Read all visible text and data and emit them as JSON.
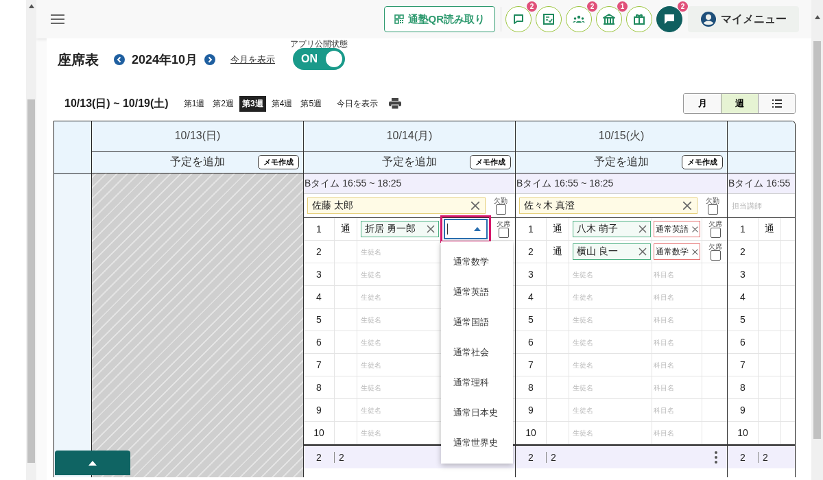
{
  "header": {
    "qr_button": "通塾QR読み取り",
    "icon_buttons": [
      {
        "kind": "chat",
        "badge": "2"
      },
      {
        "kind": "checklist"
      },
      {
        "kind": "group",
        "badge": "2"
      },
      {
        "kind": "school",
        "badge": "1"
      },
      {
        "kind": "gift"
      },
      {
        "kind": "message",
        "badge": "2"
      }
    ],
    "my_menu": "マイメニュー"
  },
  "title": "座席表",
  "month": "2024年10月",
  "this_month_link": "今月を表示",
  "publish": {
    "label": "アプリ公開状態",
    "text": "ON",
    "on": true
  },
  "week": {
    "range": "10/13(日) ~ 10/19(土)",
    "weeks": [
      {
        "label": "第1週",
        "selected": false
      },
      {
        "label": "第2週",
        "selected": false
      },
      {
        "label": "第3週",
        "selected": true
      },
      {
        "label": "第4週",
        "selected": false
      },
      {
        "label": "第5週",
        "selected": false
      }
    ],
    "today_link": "今日を表示"
  },
  "view_modes": [
    {
      "kind": "text",
      "label": "月",
      "selected": false
    },
    {
      "kind": "text",
      "label": "週",
      "selected": true
    },
    {
      "kind": "list",
      "selected": false
    }
  ],
  "days": [
    {
      "date": "10/13(日)",
      "add": "予定を追加",
      "memo": "メモ作成",
      "closed": true
    },
    {
      "date": "10/14(月)",
      "add": "予定を追加",
      "memo": "メモ作成",
      "closed": false,
      "slot": {
        "time": "Bタイム 16:55 ~ 18:25",
        "teacher": {
          "name": "佐藤 太郎",
          "absent_label": "欠勤",
          "absent": false
        },
        "rows": [
          {
            "no": "1",
            "type": "通",
            "student": "折居 勇一郎",
            "subject_focused": true,
            "absent_label": "欠席",
            "absent": false
          },
          {
            "no": "2",
            "student_placeholder": "生徒名"
          },
          {
            "no": "3",
            "student_placeholder": "生徒名"
          },
          {
            "no": "4",
            "student_placeholder": "生徒名"
          },
          {
            "no": "5",
            "student_placeholder": "生徒名"
          },
          {
            "no": "6",
            "student_placeholder": "生徒名"
          },
          {
            "no": "7",
            "student_placeholder": "生徒名"
          },
          {
            "no": "8",
            "student_placeholder": "生徒名"
          },
          {
            "no": "9",
            "student_placeholder": "生徒名"
          },
          {
            "no": "10",
            "student_placeholder": "生徒名"
          }
        ],
        "footer": [
          "2",
          "2"
        ],
        "menu": false
      }
    },
    {
      "date": "10/15(火)",
      "add": "予定を追加",
      "memo": "メモ作成",
      "closed": false,
      "slot": {
        "time": "Bタイム 16:55 ~ 18:25",
        "teacher": {
          "name": "佐々木 真澄",
          "absent_label": "欠勤",
          "absent": false
        },
        "rows": [
          {
            "no": "1",
            "type": "通",
            "student": "八木 萌子",
            "subject": "通常英語",
            "absent_label": "欠席",
            "absent": false
          },
          {
            "no": "2",
            "type": "通",
            "student": "横山 良一",
            "subject": "通常数学",
            "absent_label": "欠席",
            "absent": false
          },
          {
            "no": "3",
            "student_placeholder": "生徒名",
            "subject_placeholder": "科目名"
          },
          {
            "no": "4",
            "student_placeholder": "生徒名",
            "subject_placeholder": "科目名"
          },
          {
            "no": "5",
            "student_placeholder": "生徒名",
            "subject_placeholder": "科目名"
          },
          {
            "no": "6",
            "student_placeholder": "生徒名",
            "subject_placeholder": "科目名"
          },
          {
            "no": "7",
            "student_placeholder": "生徒名",
            "subject_placeholder": "科目名"
          },
          {
            "no": "8",
            "student_placeholder": "生徒名",
            "subject_placeholder": "科目名"
          },
          {
            "no": "9",
            "student_placeholder": "生徒名",
            "subject_placeholder": "科目名"
          },
          {
            "no": "10",
            "student_placeholder": "生徒名",
            "subject_placeholder": "科目名"
          }
        ],
        "footer": [
          "2",
          "2"
        ],
        "menu": true
      }
    },
    {
      "closed": false,
      "slot": {
        "time": "Bタイム 16:55",
        "teacher": {
          "placeholder": "担当講師"
        },
        "rows": [
          {
            "no": "1",
            "type": "通"
          },
          {
            "no": "2"
          },
          {
            "no": "3"
          },
          {
            "no": "4"
          },
          {
            "no": "5"
          },
          {
            "no": "6"
          },
          {
            "no": "7"
          },
          {
            "no": "8"
          },
          {
            "no": "9"
          },
          {
            "no": "10"
          }
        ],
        "footer": [
          "2",
          "2"
        ],
        "menu": false
      }
    }
  ],
  "subject_options": [
    "通常数学",
    "通常英語",
    "通常国語",
    "通常社会",
    "通常理科",
    "通常日本史",
    "通常世界史"
  ]
}
